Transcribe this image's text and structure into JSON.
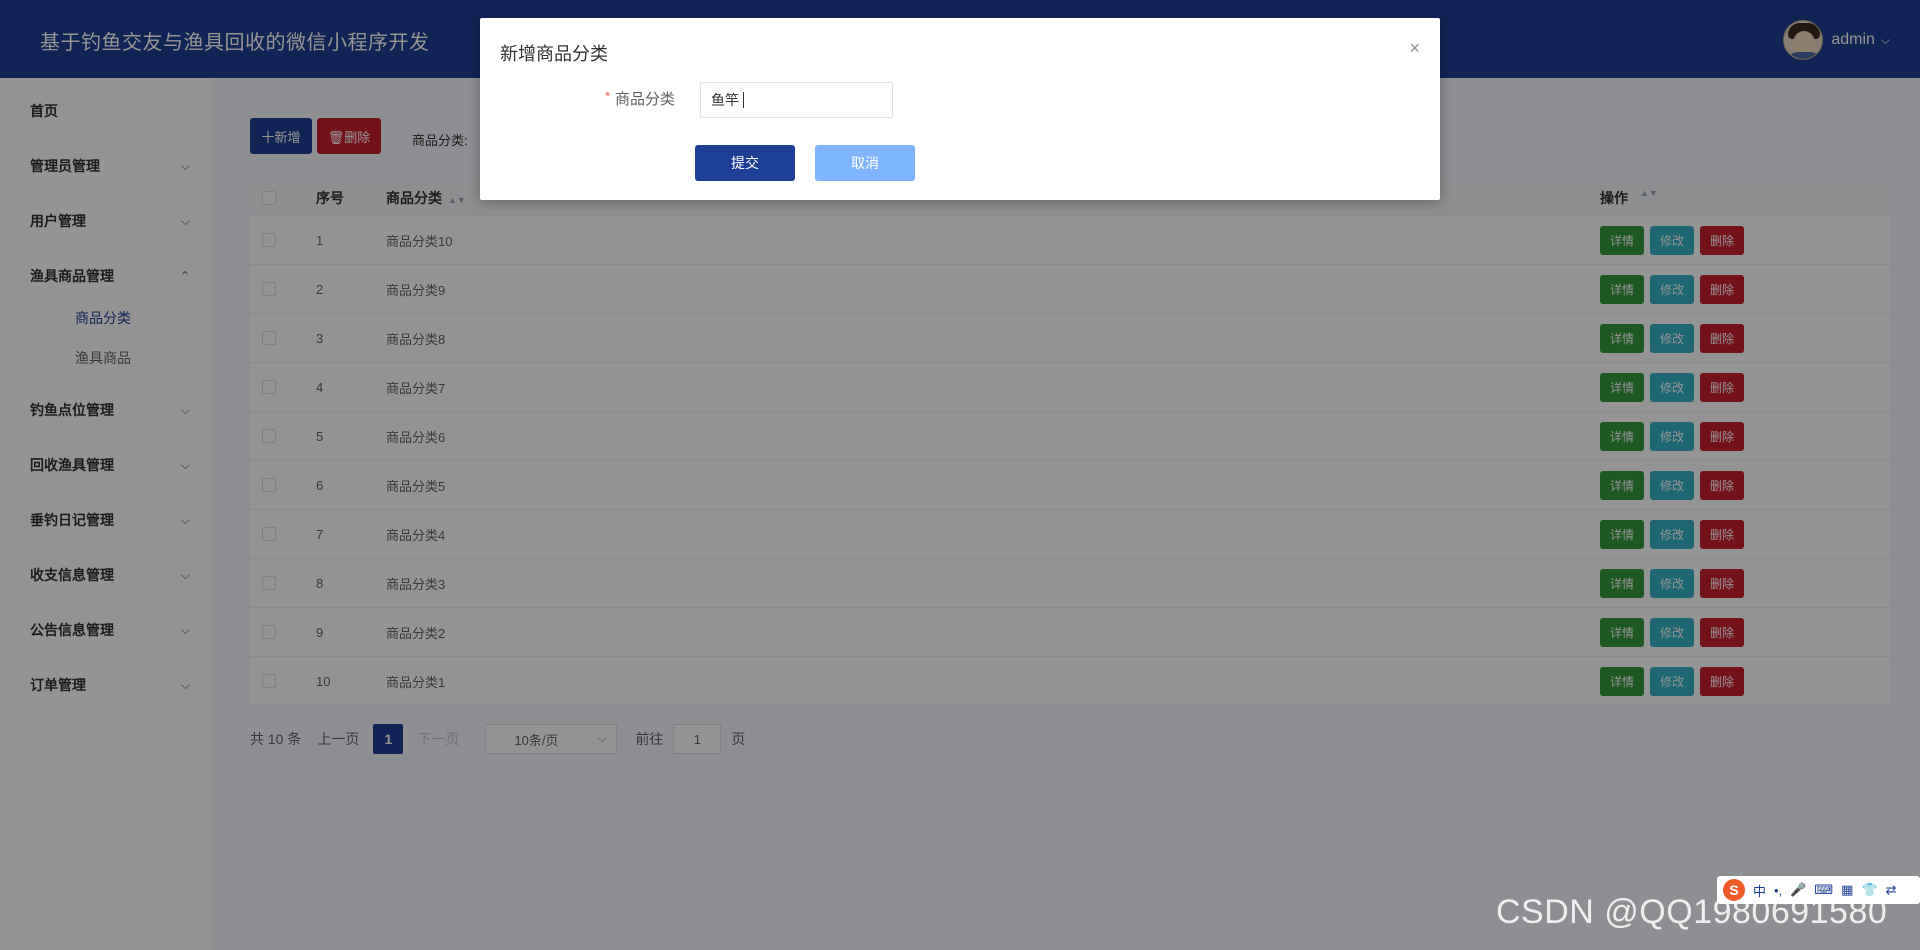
{
  "header": {
    "title": "基于钓鱼交友与渔具回收的微信小程序开发",
    "username": "admin"
  },
  "sidebar": {
    "items": [
      {
        "label": "首页",
        "has_arrow": false
      },
      {
        "label": "管理员管理",
        "arrow": "⌵"
      },
      {
        "label": "用户管理",
        "arrow": "⌵"
      },
      {
        "label": "渔具商品管理",
        "arrow": "⌃"
      },
      {
        "label": "钓鱼点位管理",
        "arrow": "⌵"
      },
      {
        "label": "回收渔具管理",
        "arrow": "⌵"
      },
      {
        "label": "垂钓日记管理",
        "arrow": "⌵"
      },
      {
        "label": "收支信息管理",
        "arrow": "⌵"
      },
      {
        "label": "公告信息管理",
        "arrow": "⌵"
      },
      {
        "label": "订单管理",
        "arrow": "⌵"
      }
    ],
    "submenu": [
      {
        "label": "商品分类",
        "active": true
      },
      {
        "label": "渔具商品",
        "active": false
      }
    ]
  },
  "toolbar": {
    "add_label": "十新增",
    "delete_label": "🗑删除",
    "search_label": "商品分类:"
  },
  "table": {
    "headers": {
      "seq": "序号",
      "name": "商品分类",
      "ops": "操作"
    },
    "rows": [
      {
        "seq": "1",
        "name": "商品分类10"
      },
      {
        "seq": "2",
        "name": "商品分类9"
      },
      {
        "seq": "3",
        "name": "商品分类8"
      },
      {
        "seq": "4",
        "name": "商品分类7"
      },
      {
        "seq": "5",
        "name": "商品分类6"
      },
      {
        "seq": "6",
        "name": "商品分类5"
      },
      {
        "seq": "7",
        "name": "商品分类4"
      },
      {
        "seq": "8",
        "name": "商品分类3"
      },
      {
        "seq": "9",
        "name": "商品分类2"
      },
      {
        "seq": "10",
        "name": "商品分类1"
      }
    ],
    "ops": {
      "detail": "详情",
      "edit": "修改",
      "delete": "删除"
    }
  },
  "pager": {
    "total": "共 10 条",
    "prev": "上一页",
    "page": "1",
    "next": "下一页",
    "size": "10条/页",
    "goto": "前往",
    "goto_value": "1",
    "page_unit": "页"
  },
  "dialog": {
    "title": "新增商品分类",
    "close": "×",
    "required_mark": "*",
    "field_label": "商品分类",
    "field_value": "鱼竿",
    "submit": "提交",
    "cancel": "取消"
  },
  "ime": {
    "logo": "S",
    "lang": "中",
    "punct": "•,",
    "mic": "🎤",
    "keyboard": "⌨",
    "grid": "▦",
    "shirt": "👕",
    "more": "⇄"
  },
  "watermark": "CSDN @QQ1980691580",
  "colors": {
    "primary": "#1c3f95",
    "danger": "#c8202e",
    "success": "#2f9a3a",
    "info": "#36b2c9",
    "cancel": "#7fb4ff"
  }
}
